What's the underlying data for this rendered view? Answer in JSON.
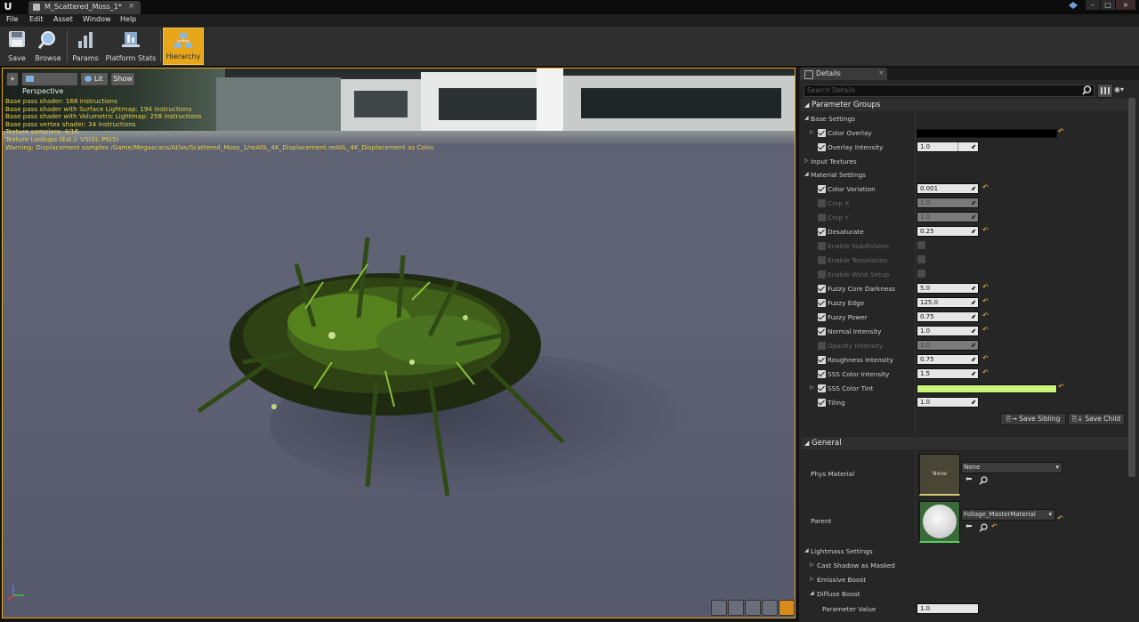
{
  "window": {
    "logo": "U",
    "tab_title": "M_Scattered_Moss_1*",
    "tab_close": "×",
    "controls": [
      "–",
      "□",
      "×"
    ]
  },
  "menu": [
    "File",
    "Edit",
    "Asset",
    "Window",
    "Help"
  ],
  "toolbar": {
    "save": "Save",
    "browse": "Browse",
    "params": "Params",
    "platform_stats": "Platform Stats",
    "hierarchy": "Hierarchy"
  },
  "viewport": {
    "perspective": "Perspective",
    "lit": "Lit",
    "show": "Show",
    "shader_info": [
      "Base pass shader: 168 instructions",
      "Base pass shader with Surface Lightmap: 194 instructions",
      "Base pass shader with Volumetric Lightmap: 258 instructions",
      "Base pass vertex shader: 34 instructions",
      "Texture samplers: 4/16",
      "Texture Lookups (Est.): VS(0), PS(5)",
      "Warning: Displacement samples /Game/Megascans/Atlas/Scattered_Moss_1/reAtlL_4K_Displacement.reAtlL_4K_Displacement as Color."
    ]
  },
  "details": {
    "tab": "Details",
    "search_placeholder": "Search Details",
    "parameter_groups": "Parameter Groups",
    "base_settings": "Base Settings",
    "color_overlay": "Color Overlay",
    "overlay_intensity": {
      "label": "Overlay Intensity",
      "value": "1.0"
    },
    "input_textures": "Input Textures",
    "material_settings": "Material Settings",
    "rows": [
      {
        "label": "Color Variation",
        "value": "0.001",
        "enabled": true
      },
      {
        "label": "Crop X",
        "value": "1.0",
        "enabled": false
      },
      {
        "label": "Crop Y",
        "value": "1.0",
        "enabled": false
      },
      {
        "label": "Desaturate",
        "value": "0.25",
        "enabled": true
      },
      {
        "label": "Enable Subdivision",
        "value": "",
        "enabled": false
      },
      {
        "label": "Enable Tesselation",
        "value": "",
        "enabled": false
      },
      {
        "label": "Enable Wind Setup",
        "value": "",
        "enabled": false
      },
      {
        "label": "Fuzzy Core Darkness",
        "value": "5.0",
        "enabled": true
      },
      {
        "label": "Fuzzy Edge",
        "value": "125.0",
        "enabled": true
      },
      {
        "label": "Fuzzy Power",
        "value": "0.75",
        "enabled": true
      },
      {
        "label": "Normal Intensity",
        "value": "1.0",
        "enabled": true
      },
      {
        "label": "Opacity Intensity",
        "value": "1.0",
        "enabled": false
      },
      {
        "label": "Roughness Intensity",
        "value": "0.75",
        "enabled": true
      },
      {
        "label": "SSS Color Intensity",
        "value": "1.5",
        "enabled": true
      }
    ],
    "sss_color_tint": "SSS Color Tint",
    "tiling": {
      "label": "Tiling",
      "value": "1.0"
    },
    "save_sibling": "Save Sibling",
    "save_child": "Save Child",
    "general": "General",
    "phys_material": {
      "label": "Phys Material",
      "thumb": "None",
      "value": "None"
    },
    "parent": {
      "label": "Parent",
      "value": "Foliage_MasterMaterial"
    },
    "lightmass_settings": "Lightmass Settings",
    "cast_shadow_masked": "Cast Shadow as Masked",
    "emissive_boost": "Emissive Boost",
    "diffuse_boost": "Diffuse Boost",
    "parameter_value": {
      "label": "Parameter Value",
      "value": "1.0"
    }
  },
  "colors": {
    "accent": "#e8a61a",
    "color_overlay": "#000000",
    "sss_tint": "#c8f57a"
  }
}
